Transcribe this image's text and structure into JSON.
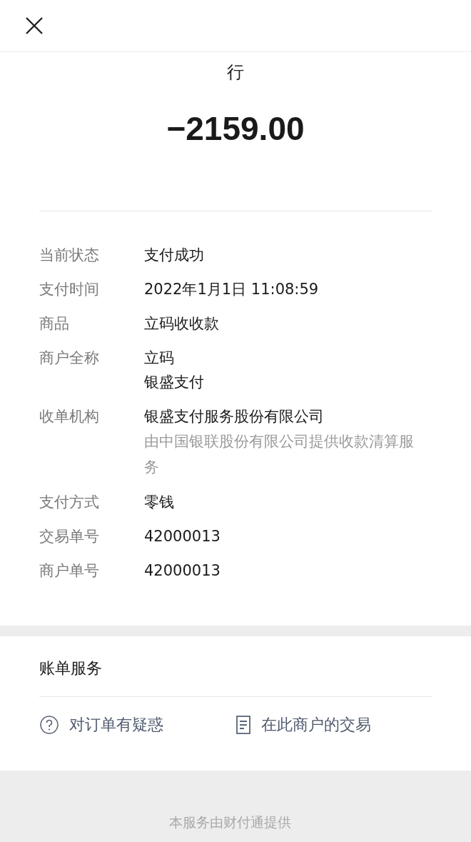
{
  "payee_partial": "行",
  "amount": "−2159.00",
  "details": [
    {
      "label": "当前状态",
      "lines": [
        {
          "text": "支付成功",
          "kind": "value"
        }
      ]
    },
    {
      "label": "支付时间",
      "lines": [
        {
          "text": "2022年1月1日 11:08:59",
          "kind": "value"
        }
      ]
    },
    {
      "label": "商品",
      "lines": [
        {
          "text": "立码收收款",
          "kind": "value"
        }
      ]
    },
    {
      "label": "商户全称",
      "lines": [
        {
          "text": "立码",
          "kind": "value"
        },
        {
          "text": "银盛支付",
          "kind": "value"
        }
      ]
    },
    {
      "label": "收单机构",
      "lines": [
        {
          "text": "银盛支付服务股份有限公司",
          "kind": "value"
        },
        {
          "text": "由中国银联股份有限公司提供收款清算服务",
          "kind": "note"
        }
      ]
    },
    {
      "label": "支付方式",
      "lines": [
        {
          "text": "零钱",
          "kind": "value"
        }
      ]
    },
    {
      "label": "交易单号",
      "lines": [
        {
          "text": "42000013",
          "kind": "value"
        }
      ]
    },
    {
      "label": "商户单号",
      "lines": [
        {
          "text": "42000013",
          "kind": "value"
        }
      ]
    }
  ],
  "bill_service": {
    "title": "账单服务",
    "actions": [
      {
        "label": "对订单有疑惑",
        "kind": "question"
      },
      {
        "label": "在此商户的交易",
        "kind": "document"
      }
    ]
  },
  "footer": "本服务由财付通提供"
}
